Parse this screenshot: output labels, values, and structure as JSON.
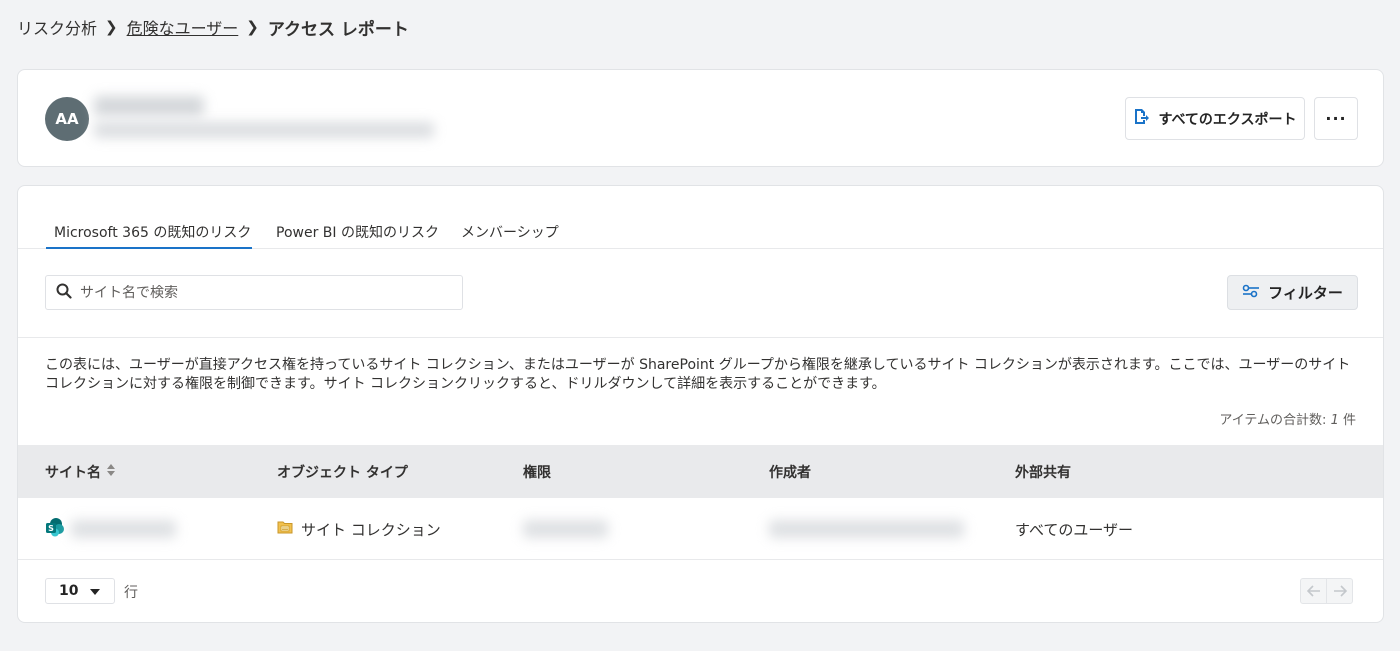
{
  "breadcrumb": {
    "items": [
      "リスク分析",
      "危険なユーザー",
      "アクセス レポート"
    ]
  },
  "user": {
    "initials": "AA",
    "avatar_color": "#5e6d73"
  },
  "header_actions": {
    "export_label": "すべてのエクスポート",
    "more_label": "···"
  },
  "tabs": [
    {
      "label": "Microsoft 365 の既知のリスク",
      "active": true
    },
    {
      "label": "Power BI の既知のリスク",
      "active": false
    },
    {
      "label": "メンバーシップ",
      "active": false
    }
  ],
  "search": {
    "placeholder": "サイト名で検索"
  },
  "filter": {
    "label": "フィルター"
  },
  "description": "この表には、ユーザーが直接アクセス権を持っているサイト コレクション、またはユーザーが SharePoint グループから権限を継承しているサイト コレクションが表示されます。ここでは、ユーザーのサイト コレクションに対する権限を制御できます。サイト コレクションクリックすると、ドリルダウンして詳細を表示することができます。",
  "item_count": {
    "label": "アイテムの合計数: ",
    "value": "1",
    "unit": "件"
  },
  "table": {
    "columns": [
      "サイト名",
      "オブジェクト タイプ",
      "権限",
      "作成者",
      "外部共有"
    ],
    "rows": [
      {
        "object_type": "サイト コレクション",
        "external_sharing": "すべてのユーザー"
      }
    ]
  },
  "pagination": {
    "page_size": "10",
    "rows_label": "行"
  },
  "colors": {
    "accent": "#1a73c8",
    "background": "#f2f3f5"
  }
}
